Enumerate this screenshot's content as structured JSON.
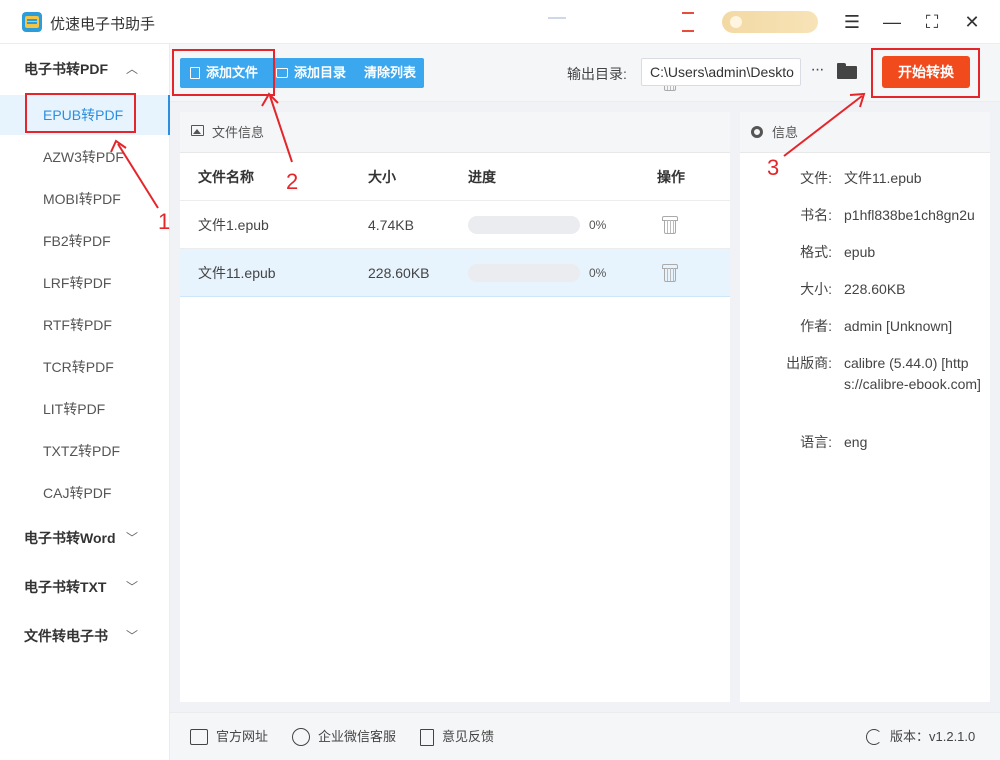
{
  "app": {
    "title": "优速电子书助手"
  },
  "sidebar": {
    "groups": [
      {
        "label": "电子书转PDF",
        "expanded": true
      },
      {
        "label": "电子书转Word",
        "expanded": false
      },
      {
        "label": "电子书转TXT",
        "expanded": false
      },
      {
        "label": "文件转电子书",
        "expanded": false
      }
    ],
    "items": [
      "EPUB转PDF",
      "AZW3转PDF",
      "MOBI转PDF",
      "FB2转PDF",
      "LRF转PDF",
      "RTF转PDF",
      "TCR转PDF",
      "LIT转PDF",
      "TXTZ转PDF",
      "CAJ转PDF"
    ],
    "active_item": "EPUB转PDF"
  },
  "toolbar": {
    "add_file": "添加文件",
    "add_folder": "添加目录",
    "clear_list": "清除列表",
    "output_label": "输出目录:",
    "output_path": "C:\\Users\\admin\\Deskto",
    "more": "···",
    "start": "开始转换"
  },
  "file_panel": {
    "title": "文件信息",
    "columns": {
      "name": "文件名称",
      "size": "大小",
      "progress": "进度",
      "action": "操作"
    },
    "rows": [
      {
        "name": "文件1.epub",
        "size": "4.74KB",
        "progress": 0,
        "progress_text": "0%",
        "selected": false
      },
      {
        "name": "文件11.epub",
        "size": "228.60KB",
        "progress": 0,
        "progress_text": "0%",
        "selected": true
      }
    ]
  },
  "info_panel": {
    "title": "信息",
    "fields": [
      {
        "label": "文件:",
        "value": "文件11.epub"
      },
      {
        "label": "书名:",
        "value": "p1hfl838be1ch8gn2u"
      },
      {
        "label": "格式:",
        "value": "epub"
      },
      {
        "label": "大小:",
        "value": "228.60KB"
      },
      {
        "label": "作者:",
        "value": "admin [Unknown]"
      },
      {
        "label": "出版商:",
        "value": "calibre (5.44.0) [https://calibre-ebook.com]"
      },
      {
        "label": "语言:",
        "value": "eng"
      }
    ]
  },
  "footer": {
    "website": "官方网址",
    "wechat": "企业微信客服",
    "feedback": "意见反馈",
    "version": "版本：v1.2.1.0"
  },
  "annotations": {
    "step1": "1",
    "step2": "2",
    "step3": "3",
    "color": "#e4262b"
  },
  "colors": {
    "accent": "#3aa7ee",
    "start_button": "#f04a1d",
    "active_item": "#2a8fe0"
  }
}
